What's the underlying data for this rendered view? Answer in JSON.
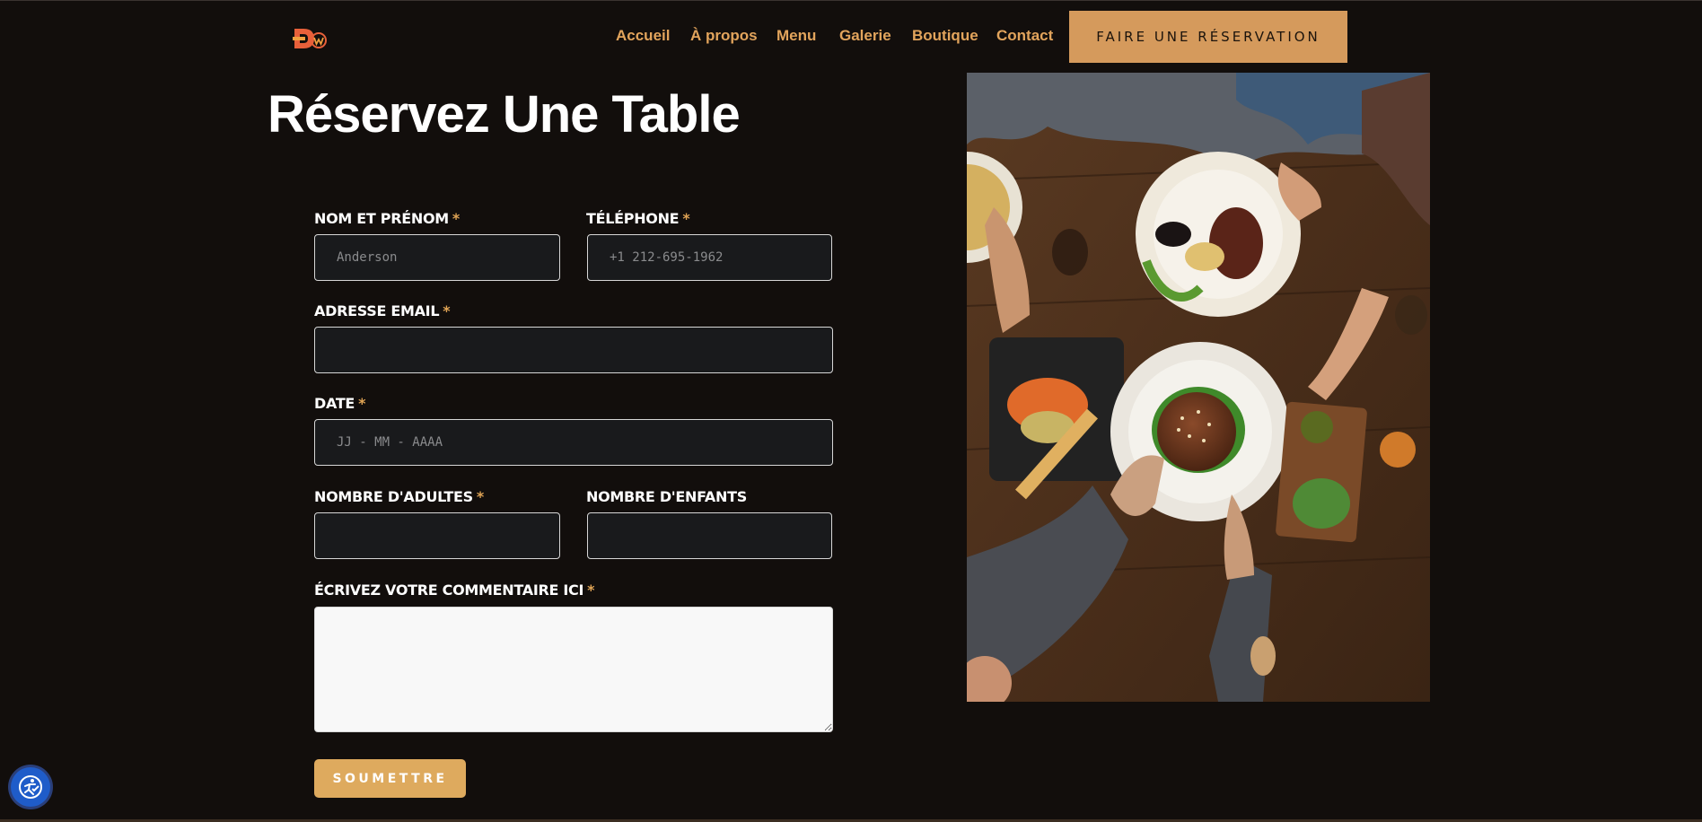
{
  "header": {
    "logo_icon": "dw-logo",
    "nav": [
      "Accueil",
      "À propos",
      "Menu",
      "Galerie",
      "Boutique",
      "Contact"
    ],
    "reserve_label": "FAIRE UNE RÉSERVATION"
  },
  "main": {
    "title": "Réservez Une Table",
    "form": {
      "name_label": "NOM ET PRÉNOM",
      "name_placeholder": "Anderson",
      "phone_label": "TÉLÉPHONE",
      "phone_placeholder": "+1 212-695-1962",
      "email_label": "ADRESSE EMAIL",
      "date_label": "DATE",
      "date_placeholder": "JJ - MM - AAAA",
      "adults_label": "NOMBRE D'ADULTES",
      "children_label": "NOMBRE D'ENFANTS",
      "comment_label": "ÉCRIVEZ VOTRE COMMENTAIRE ICI",
      "required_mark": "*",
      "submit_label": "SOUMETTRE"
    },
    "photo_icon": "restaurant-table-photo"
  },
  "accessibility_icon": "accessibility-icon",
  "colors": {
    "background": "#120e0c",
    "accent": "#e2a45c",
    "button": "#d59a5c",
    "submit": "#deaa5e",
    "field_bg": "#191a1c"
  }
}
